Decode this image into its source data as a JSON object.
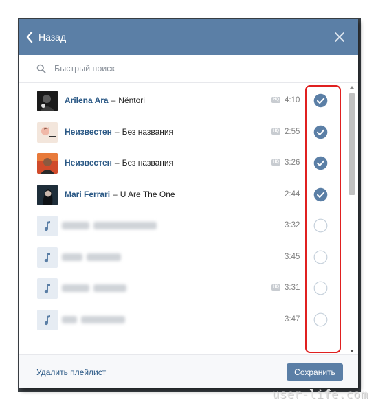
{
  "header": {
    "back_label": "Назад"
  },
  "search": {
    "placeholder": "Быстрый поиск",
    "value": ""
  },
  "tracks": [
    {
      "artist": "Arilena Ara",
      "title": "Nëntori",
      "duration": "4:10",
      "hq": true,
      "checked": true,
      "cover": "photo"
    },
    {
      "artist": "Неизвестен",
      "title": "Без названия",
      "duration": "2:55",
      "hq": true,
      "checked": true,
      "cover": "photo"
    },
    {
      "artist": "Неизвестен",
      "title": "Без названия",
      "duration": "3:26",
      "hq": true,
      "checked": true,
      "cover": "photo"
    },
    {
      "artist": "Mari Ferrari",
      "title": "U Are The One",
      "duration": "2:44",
      "hq": false,
      "checked": true,
      "cover": "photo"
    },
    {
      "artist": "",
      "title": "",
      "duration": "3:32",
      "hq": false,
      "checked": false,
      "cover": "note",
      "blurred": true
    },
    {
      "artist": "",
      "title": "",
      "duration": "3:45",
      "hq": false,
      "checked": false,
      "cover": "note",
      "blurred": true
    },
    {
      "artist": "",
      "title": "",
      "duration": "3:31",
      "hq": true,
      "checked": false,
      "cover": "note",
      "blurred": true
    },
    {
      "artist": "",
      "title": "",
      "duration": "3:47",
      "hq": false,
      "checked": false,
      "cover": "note",
      "blurred": true
    }
  ],
  "hq_badge": "HQ",
  "footer": {
    "delete_label": "Удалить плейлист",
    "save_label": "Сохранить"
  },
  "colors": {
    "accent": "#5b7fa6",
    "link": "#2a5885",
    "highlight": "#e02020"
  },
  "watermark": "user-life.com"
}
